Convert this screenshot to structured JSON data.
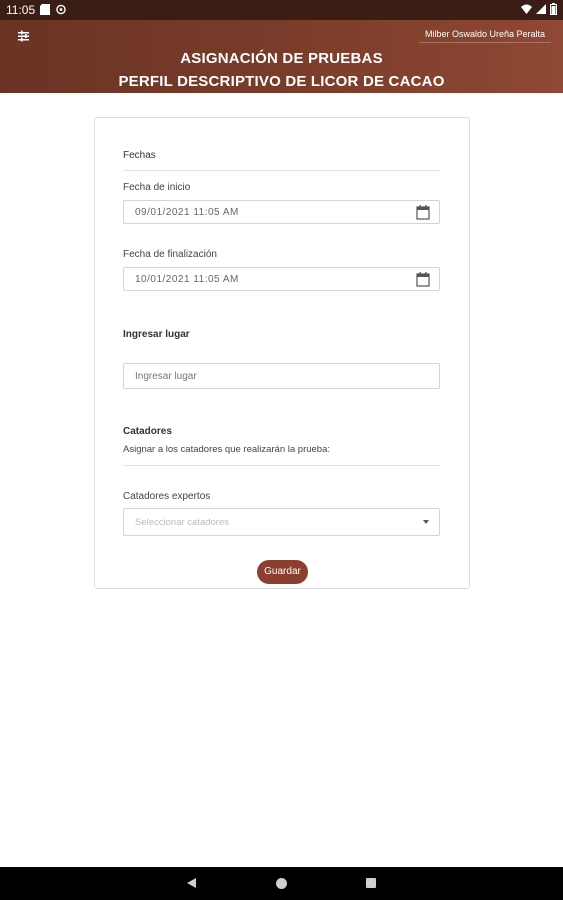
{
  "status_bar": {
    "time": "11:05"
  },
  "app_bar": {
    "user_name": "Milber Oswaldo Ureña Peralta",
    "title_line1": "ASIGNACIÓN DE PRUEBAS",
    "title_line2": "PERFIL DESCRIPTIVO DE LICOR DE CACAO"
  },
  "form": {
    "dates_section": "Fechas",
    "start_label": "Fecha de inicio",
    "start_value": "09/01/2021 11:05 AM",
    "end_label": "Fecha de finalización",
    "end_value": "10/01/2021 11:05 AM",
    "place_label": "Ingresar lugar",
    "place_placeholder": "Ingresar lugar",
    "tasters_section": "Catadores",
    "tasters_desc": "Asignar a los catadores que realizarán la prueba:",
    "experts_label": "Catadores expertos",
    "experts_placeholder": "Seleccionar catadores",
    "save_label": "Guardar"
  },
  "colors": {
    "primary": "#7a3c2a",
    "button": "#8c3f2f"
  }
}
